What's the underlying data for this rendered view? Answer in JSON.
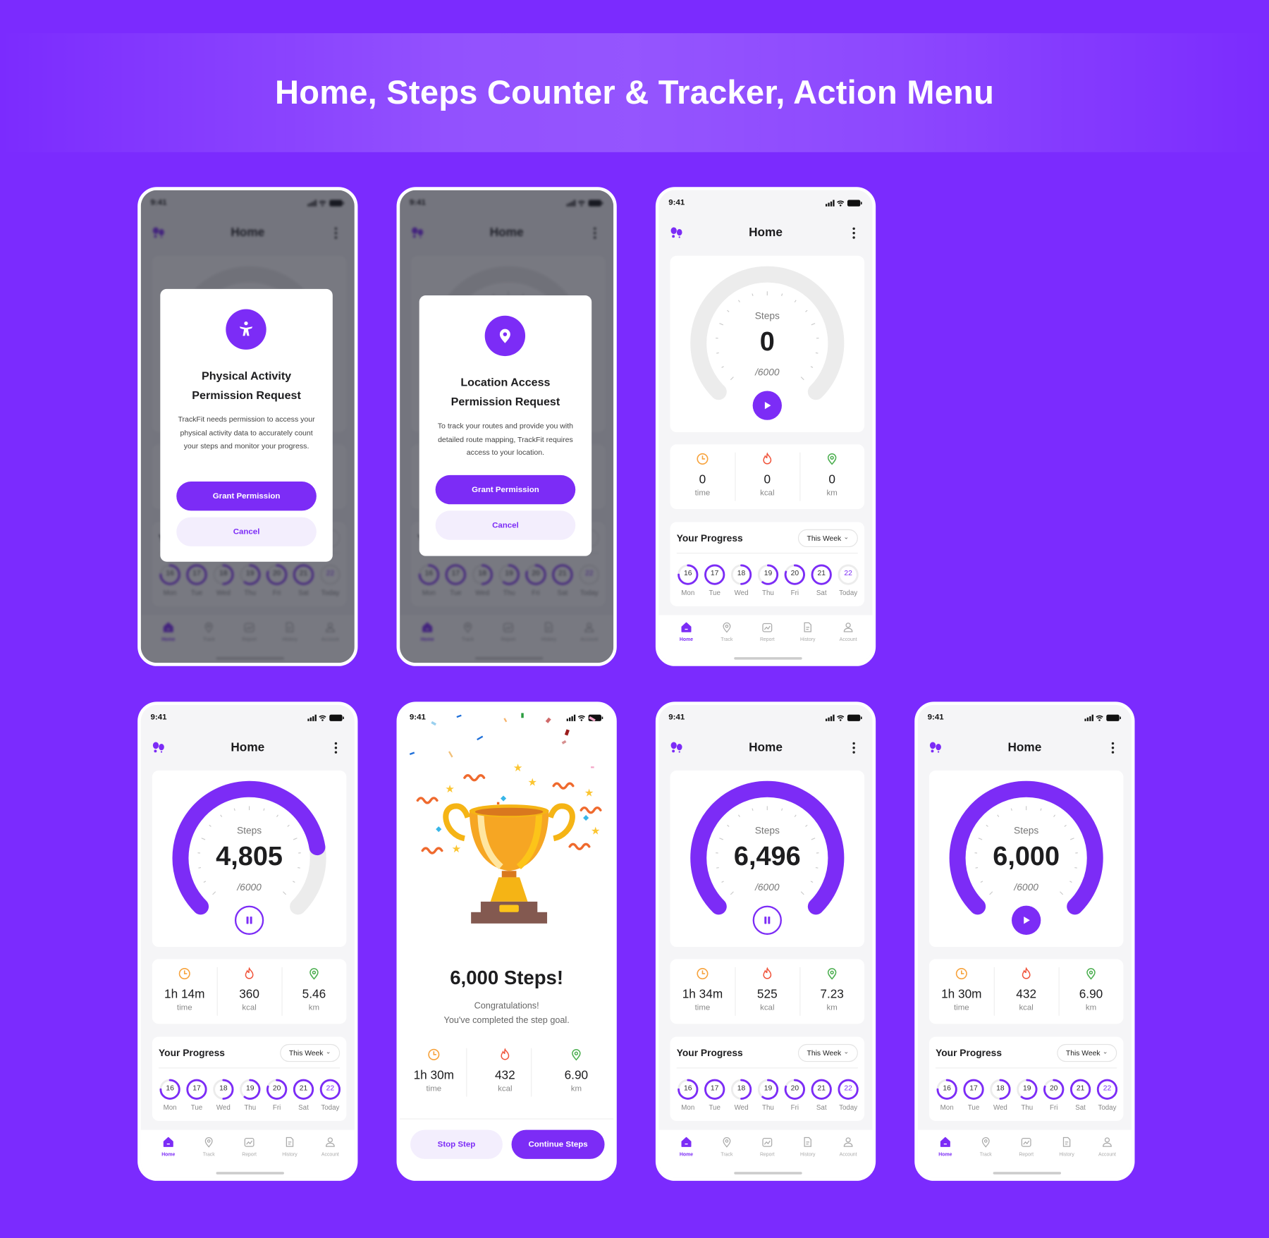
{
  "banner": {
    "title": "Home, Steps Counter & Tracker, Action Menu"
  },
  "colors": {
    "background": "#7B2BFE",
    "accent": "#7C2CF6",
    "time": "#F7A23B",
    "kcal": "#F0533A",
    "km": "#4CAF50",
    "track": "#ECECEC"
  },
  "common": {
    "status_time": "9:41",
    "header_title": "Home",
    "steps_label": "Steps",
    "goal": "/6000",
    "goal_value": 6000,
    "stat_labels": [
      "time",
      "kcal",
      "km"
    ],
    "progress_title": "Your Progress",
    "range": "This Week",
    "days": [
      {
        "num": "16",
        "label": "Mon"
      },
      {
        "num": "17",
        "label": "Tue"
      },
      {
        "num": "18",
        "label": "Wed"
      },
      {
        "num": "19",
        "label": "Thu"
      },
      {
        "num": "20",
        "label": "Fri"
      },
      {
        "num": "21",
        "label": "Sat"
      },
      {
        "num": "22",
        "label": "Today"
      }
    ],
    "nav": [
      {
        "label": "Home",
        "icon": "home-icon",
        "active": true
      },
      {
        "label": "Track",
        "icon": "location-icon",
        "active": false
      },
      {
        "label": "Report",
        "icon": "chart-icon",
        "active": false
      },
      {
        "label": "History",
        "icon": "document-icon",
        "active": false
      },
      {
        "label": "Account",
        "icon": "user-icon",
        "active": false
      }
    ]
  },
  "screens": [
    {
      "type": "permission",
      "icon": "accessibility-icon",
      "title_line1": "Physical Activity",
      "title_line2": "Permission Request",
      "body": "TrackFit needs permission to access your physical activity data to accurately count your steps and monitor your progress.",
      "grant": "Grant Permission",
      "cancel": "Cancel"
    },
    {
      "type": "permission",
      "icon": "location-pin-icon",
      "title_line1": "Location Access",
      "title_line2": "Permission Request",
      "body": "To track your routes and provide you with detailed route mapping, TrackFit requires access to your location.",
      "grant": "Grant Permission",
      "cancel": "Cancel"
    },
    {
      "type": "home",
      "steps": "0",
      "progress": 0,
      "control": "play",
      "stats": [
        "0",
        "0",
        "0"
      ],
      "day_progress": [
        0.75,
        1,
        0.5,
        0.6,
        0.8,
        1,
        0
      ]
    },
    {
      "type": "home",
      "steps": "4,805",
      "progress": 0.8,
      "control": "pause",
      "stats": [
        "1h 14m",
        "360",
        "5.46"
      ],
      "day_progress": [
        0.75,
        1,
        0.5,
        0.6,
        0.8,
        1,
        1
      ]
    },
    {
      "type": "celebration",
      "title": "6,000 Steps!",
      "line1": "Congratulations!",
      "line2": "You've completed the step goal.",
      "stats": [
        "1h 30m",
        "432",
        "6.90"
      ],
      "stop": "Stop Step",
      "continue": "Continue Steps"
    },
    {
      "type": "home",
      "steps": "6,496",
      "progress": 1,
      "control": "pause",
      "stats": [
        "1h 34m",
        "525",
        "7.23"
      ],
      "day_progress": [
        0.75,
        1,
        0.5,
        0.6,
        0.8,
        1,
        1
      ]
    },
    {
      "type": "home",
      "steps": "6,000",
      "progress": 1,
      "control": "play",
      "stats": [
        "1h 30m",
        "432",
        "6.90"
      ],
      "day_progress": [
        0.75,
        1,
        0.5,
        0.6,
        0.8,
        1,
        1
      ]
    }
  ]
}
